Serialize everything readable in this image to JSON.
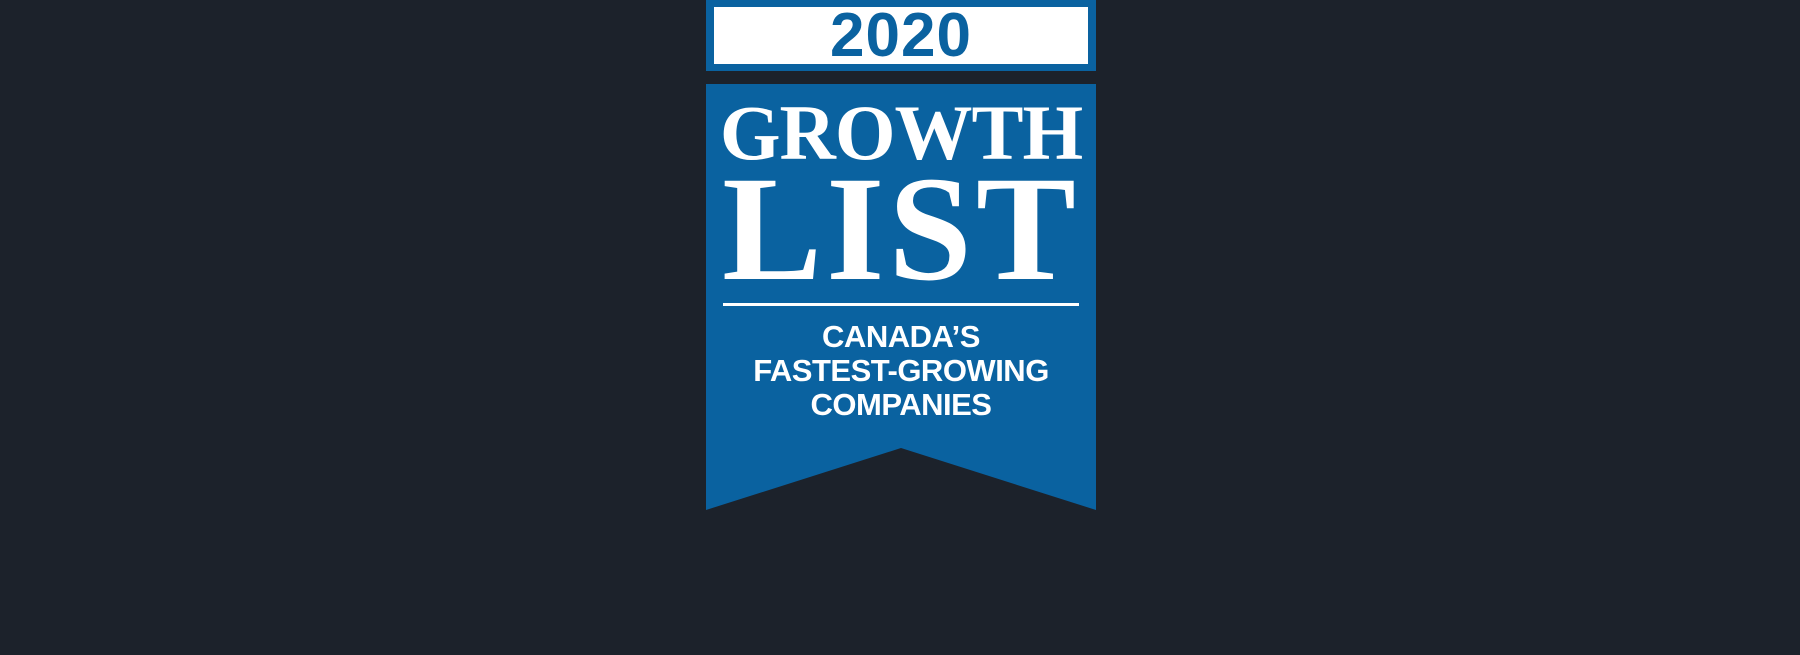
{
  "badge": {
    "year": "2020",
    "title_line1": "GROWTH",
    "title_line2": "LIST",
    "subtitle_lines": [
      "CANADA’S",
      "FASTEST-GROWING",
      "COMPANIES"
    ]
  },
  "colors": {
    "background": "#1c222b",
    "brand_blue": "#0a62a0",
    "text_white": "#ffffff"
  }
}
